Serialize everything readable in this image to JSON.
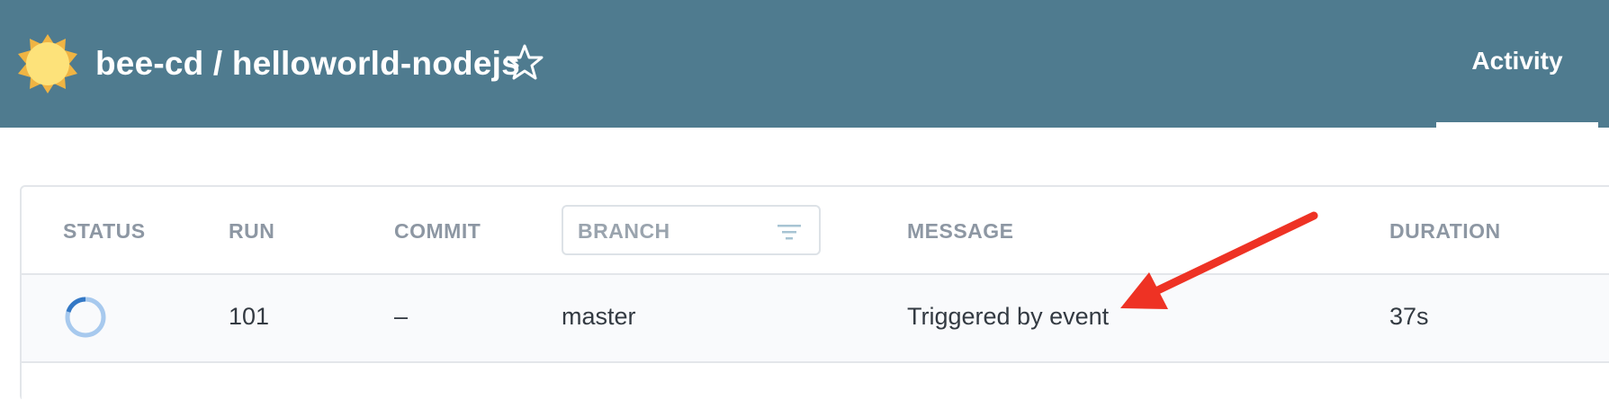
{
  "header": {
    "title": "bee-cd / helloworld-nodejs",
    "tabs": [
      {
        "label": "Activity"
      }
    ],
    "icons": {
      "logo": "weather-sunny-icon",
      "favorite": "star-outline-icon"
    },
    "colors": {
      "background": "#4f7b8f",
      "logo_sun": "#fde27a",
      "logo_rays": "#f0b443"
    }
  },
  "table": {
    "columns": {
      "status": "STATUS",
      "run": "RUN",
      "commit": "COMMIT",
      "branch_placeholder": "BRANCH",
      "message": "MESSAGE",
      "duration": "DURATION"
    },
    "rows": [
      {
        "status": "running",
        "status_icon": "in-progress-ring-icon",
        "run": "101",
        "commit": "–",
        "branch": "master",
        "message": "Triggered by event",
        "duration": "37s"
      }
    ]
  },
  "annotation": {
    "type": "arrow",
    "color": "#ee3224"
  }
}
